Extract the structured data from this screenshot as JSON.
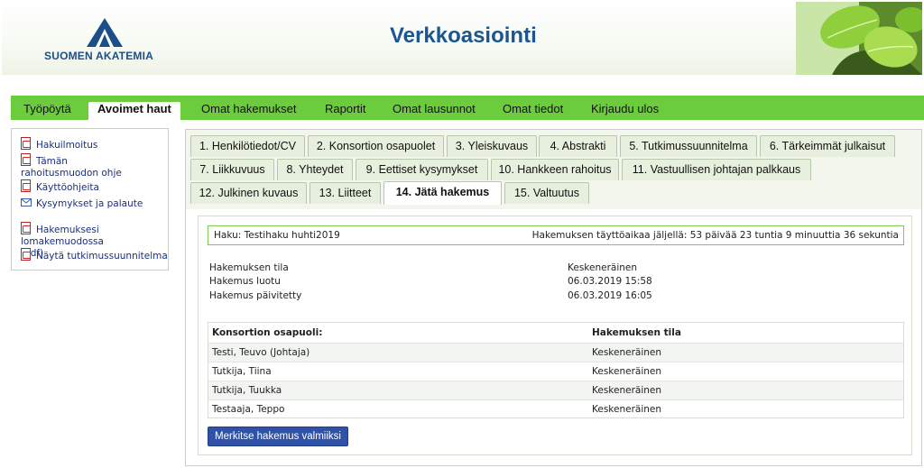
{
  "header": {
    "logo_text": "SUOMEN AKATEMIA",
    "title": "Verkkoasiointi"
  },
  "nav": {
    "items": [
      {
        "label": "Työpöytä"
      },
      {
        "label": "Avoimet haut",
        "active": true
      },
      {
        "label": "Omat hakemukset"
      },
      {
        "label": "Raportit"
      },
      {
        "label": "Omat lausunnot"
      },
      {
        "label": "Omat tiedot"
      },
      {
        "label": "Kirjaudu ulos"
      }
    ]
  },
  "sidebar": {
    "links": [
      {
        "label": "Hakuilmoitus",
        "icon": "pdf-icon"
      },
      {
        "label": "Tämän rahoitusmuodon ohje",
        "icon": "pdf-icon"
      },
      {
        "label": "Käyttöohjeita",
        "icon": "pdf-icon"
      },
      {
        "label": "Kysymykset ja palaute",
        "icon": "mail-icon"
      },
      {
        "label": "Hakemuksesi lomakemuodossa (pdf)",
        "icon": "pdf-icon"
      },
      {
        "label": "Näytä tutkimussuunnitelma",
        "icon": "pdf-icon"
      }
    ]
  },
  "tabs": [
    {
      "label": "1. Henkilötiedot/CV"
    },
    {
      "label": "2. Konsortion osapuolet"
    },
    {
      "label": "3. Yleiskuvaus"
    },
    {
      "label": "4. Abstrakti"
    },
    {
      "label": "5. Tutkimussuunnitelma"
    },
    {
      "label": "6. Tärkeimmät julkaisut"
    },
    {
      "label": "7. Liikkuvuus"
    },
    {
      "label": "8. Yhteydet"
    },
    {
      "label": "9. Eettiset kysymykset"
    },
    {
      "label": "10. Hankkeen rahoitus"
    },
    {
      "label": "11. Vastuullisen johtajan palkkaus"
    },
    {
      "label": "12. Julkinen kuvaus"
    },
    {
      "label": "13. Liitteet"
    },
    {
      "label": "14. Jätä hakemus",
      "active": true
    },
    {
      "label": "15. Valtuutus"
    }
  ],
  "main": {
    "haku": "Haku: Testihaku huhti2019",
    "deadline": "Hakemuksen täyttöaikaa jäljellä: 53 päivää 23 tuntia 9 minuuttia 36 sekuntia",
    "info": [
      {
        "label": "Hakemuksen tila",
        "value": "Keskeneräinen"
      },
      {
        "label": "Hakemus luotu",
        "value": "06.03.2019 15:58"
      },
      {
        "label": "Hakemus päivitetty",
        "value": "06.03.2019 16:05"
      }
    ],
    "table": {
      "headers": [
        "Konsortion osapuoli:",
        "Hakemuksen tila"
      ],
      "rows": [
        [
          "Testi, Teuvo (Johtaja)",
          "Keskeneräinen"
        ],
        [
          "Tutkija, Tiina",
          "Keskeneräinen"
        ],
        [
          "Tutkija, Tuukka",
          "Keskeneräinen"
        ],
        [
          "Testaaja, Teppo",
          "Keskeneräinen"
        ]
      ]
    },
    "submit_label": "Merkitse hakemus valmiiksi"
  }
}
